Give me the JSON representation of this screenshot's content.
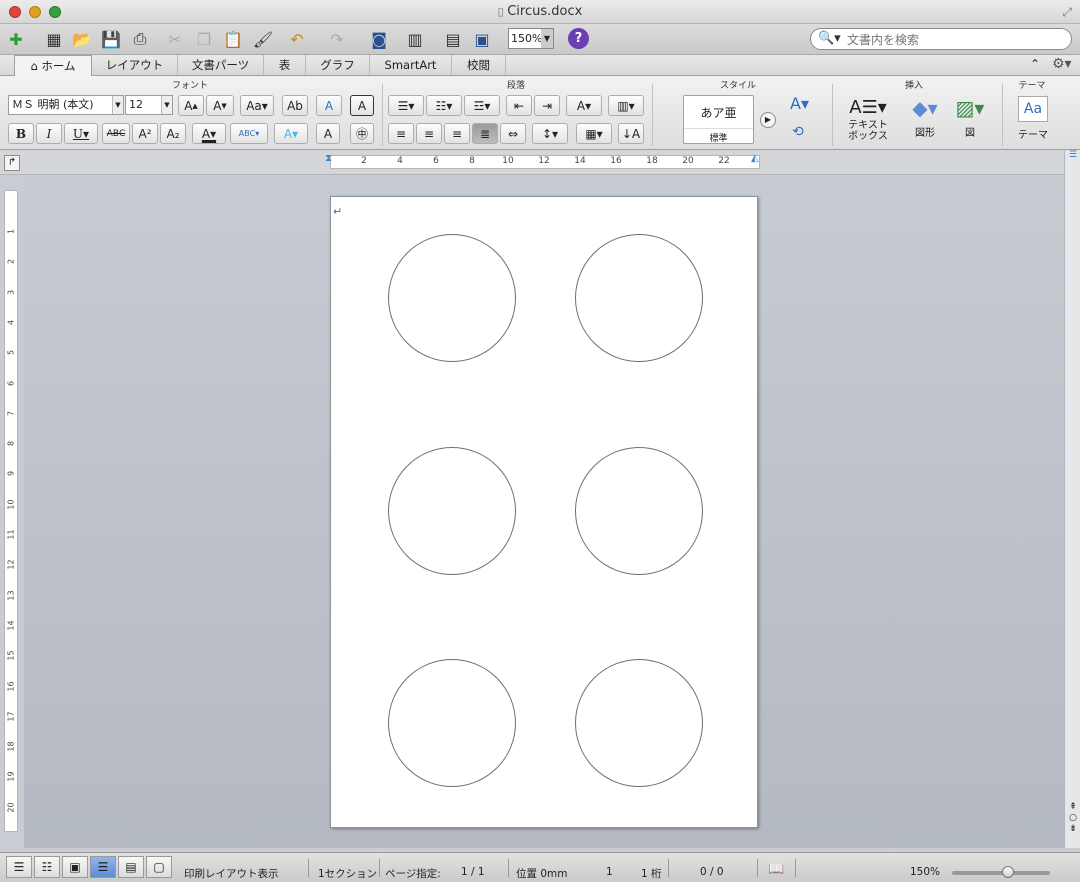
{
  "window": {
    "title": "Circus.docx"
  },
  "toolbar": {
    "zoom_value": "150%",
    "search_placeholder": "文書内を検索",
    "icons": [
      "new-doc-icon",
      "templates-icon",
      "open-icon",
      "save-icon",
      "print-icon",
      "cut-icon",
      "copy-icon",
      "paste-icon",
      "format-painter-icon",
      "undo-icon",
      "redo-icon",
      "toolbox-icon",
      "sidebar-icon",
      "gallery-icon",
      "media-icon",
      "help-icon"
    ]
  },
  "ribbon_tabs": [
    "ホーム",
    "レイアウト",
    "文書パーツ",
    "表",
    "グラフ",
    "SmartArt",
    "校閲"
  ],
  "ribbon": {
    "groups": {
      "font": "フォント",
      "paragraph": "段落",
      "style": "スタイル",
      "insert": "挿入",
      "theme": "テーマ"
    },
    "font_name": "ＭＳ 明朝 (本文)",
    "font_size": "12",
    "style_sample": "あア亜",
    "style_name": "標準",
    "textbox_label": "テキスト\nボックス",
    "shape_label": "図形",
    "picture_label": "図",
    "theme_label": "テーマ",
    "theme_sample": "Aa"
  },
  "ruler": {
    "h_labels": [
      "2",
      "4",
      "6",
      "8",
      "10",
      "12",
      "14",
      "16",
      "18",
      "20",
      "22"
    ],
    "v_labels": [
      "1",
      "2",
      "3",
      "4",
      "5",
      "6",
      "7",
      "8",
      "9",
      "10",
      "11",
      "12",
      "13",
      "14",
      "15",
      "16",
      "17",
      "18",
      "19",
      "20"
    ]
  },
  "document": {
    "paragraph_mark": "↵",
    "circle_count": 6
  },
  "status": {
    "view_name": "印刷レイアウト表示",
    "section": "1セクション",
    "page_label": "ページ指定:",
    "page_value": "1 / 1",
    "position": "位置 0mm",
    "line": "1",
    "column": "1 桁",
    "words": "0 / 0",
    "zoom": "150%"
  },
  "colors": {
    "accent": "#5a8dd3",
    "help": "#6a3fb5",
    "close": "#e0443e",
    "minimize": "#dea123",
    "maximize": "#34a33f"
  }
}
